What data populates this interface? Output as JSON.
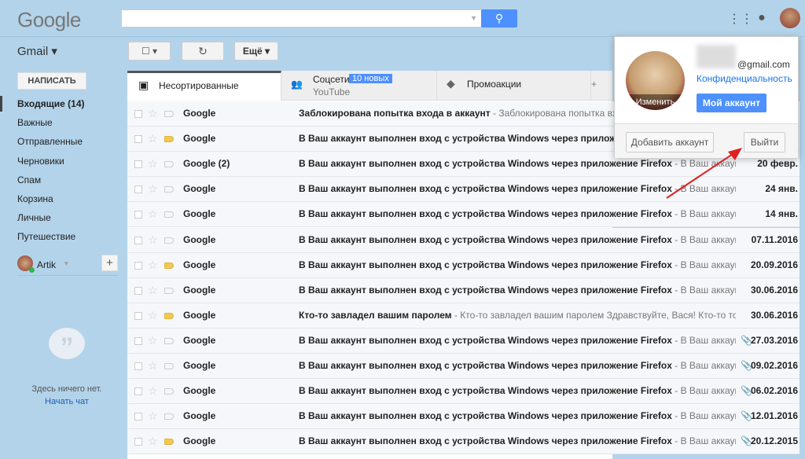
{
  "header": {
    "logo": "Google",
    "search_value": "",
    "app_label": "Gmail"
  },
  "toolbar": {
    "more_label": "Ещё"
  },
  "sidebar": {
    "compose": "НАПИСАТЬ",
    "items": [
      "Входящие (14)",
      "Важные",
      "Отправленные",
      "Черновики",
      "Спам",
      "Корзина",
      "Личные",
      "Путешествие"
    ],
    "user": "Artik",
    "empty_chat": "Здесь ничего нет.",
    "start_chat": "Начать чат"
  },
  "tabs": [
    {
      "label": "Несортированные"
    },
    {
      "label": "Соцсети",
      "badge": "10 новых",
      "sub": "YouTube"
    },
    {
      "label": "Промоакции"
    }
  ],
  "emails": [
    {
      "sender": "Google",
      "subject": "Заблокирована попытка входа в аккаунт",
      "snippet": " - Заблокирована попытка входа",
      "date": "",
      "label": false,
      "clip": false
    },
    {
      "sender": "Google",
      "subject": "В Ваш аккаунт выполнен вход с устройства Windows через приложение Firefox",
      "snippet": " - В Ваш аккаунт выг",
      "date": "",
      "label": true,
      "clip": false
    },
    {
      "sender": "Google (2)",
      "subject": "В Ваш аккаунт выполнен вход с устройства Windows через приложение Firefox",
      "snippet": " - В Ваш аккаунт выг",
      "date": "20 февр.",
      "label": false,
      "clip": false
    },
    {
      "sender": "Google",
      "subject": "В Ваш аккаунт выполнен вход с устройства Windows через приложение Firefox",
      "snippet": " - В Ваш аккаунт выг",
      "date": "24 янв.",
      "label": false,
      "clip": false
    },
    {
      "sender": "Google",
      "subject": "В Ваш аккаунт выполнен вход с устройства Windows через приложение Firefox",
      "snippet": " - В Ваш аккаунт выг",
      "date": "14 янв.",
      "label": false,
      "clip": false
    },
    {
      "sender": "Google",
      "subject": "В Ваш аккаунт выполнен вход с устройства Windows через приложение Firefox",
      "snippet": " - В Ваш аккаунт выг",
      "date": "07.11.2016",
      "label": false,
      "clip": false
    },
    {
      "sender": "Google",
      "subject": "В Ваш аккаунт выполнен вход с устройства Windows через приложение Firefox",
      "snippet": " - В Ваш аккаунт выг",
      "date": "20.09.2016",
      "label": true,
      "clip": false
    },
    {
      "sender": "Google",
      "subject": "В Ваш аккаунт выполнен вход с устройства Windows через приложение Firefox",
      "snippet": " - В Ваш аккаунт выг",
      "date": "30.06.2016",
      "label": false,
      "clip": false
    },
    {
      "sender": "Google",
      "subject": "Кто-то завладел вашим паролем",
      "snippet": " - Кто-то завладел вашим паролем Здравствуйте, Вася! Кто-то только ч",
      "date": "30.06.2016",
      "label": true,
      "clip": false
    },
    {
      "sender": "Google",
      "subject": "В Ваш аккаунт выполнен вход с устройства Windows через приложение Firefox",
      "snippet": " - В Ваш аккаунт выг",
      "date": "27.03.2016",
      "label": false,
      "clip": true
    },
    {
      "sender": "Google",
      "subject": "В Ваш аккаунт выполнен вход с устройства Windows через приложение Firefox",
      "snippet": " - В Ваш аккаунт выг",
      "date": "09.02.2016",
      "label": false,
      "clip": true
    },
    {
      "sender": "Google",
      "subject": "В Ваш аккаунт выполнен вход с устройства Windows через приложение Firefox",
      "snippet": " - В Ваш аккаунт выг",
      "date": "06.02.2016",
      "label": false,
      "clip": true
    },
    {
      "sender": "Google",
      "subject": "В Ваш аккаунт выполнен вход с устройства Windows через приложение Firefox",
      "snippet": " - В Ваш аккаунт выг",
      "date": "12.01.2016",
      "label": false,
      "clip": true
    },
    {
      "sender": "Google",
      "subject": "В Ваш аккаунт выполнен вход с устройства Windows через приложение Firefox",
      "snippet": " - В Ваш аккаунт выг",
      "date": "20.12.2015",
      "label": true,
      "clip": true
    }
  ],
  "account_popup": {
    "email": "@gmail.com",
    "privacy": "Конфиденциальность",
    "my_account": "Мой аккаунт",
    "change": "Изменить",
    "add_account": "Добавить аккаунт",
    "sign_out": "Выйти"
  },
  "colors": {
    "background": "#b3d3ea",
    "accent": "#4d90fe",
    "label": "#f2c94c",
    "arrow": "#e02020"
  }
}
